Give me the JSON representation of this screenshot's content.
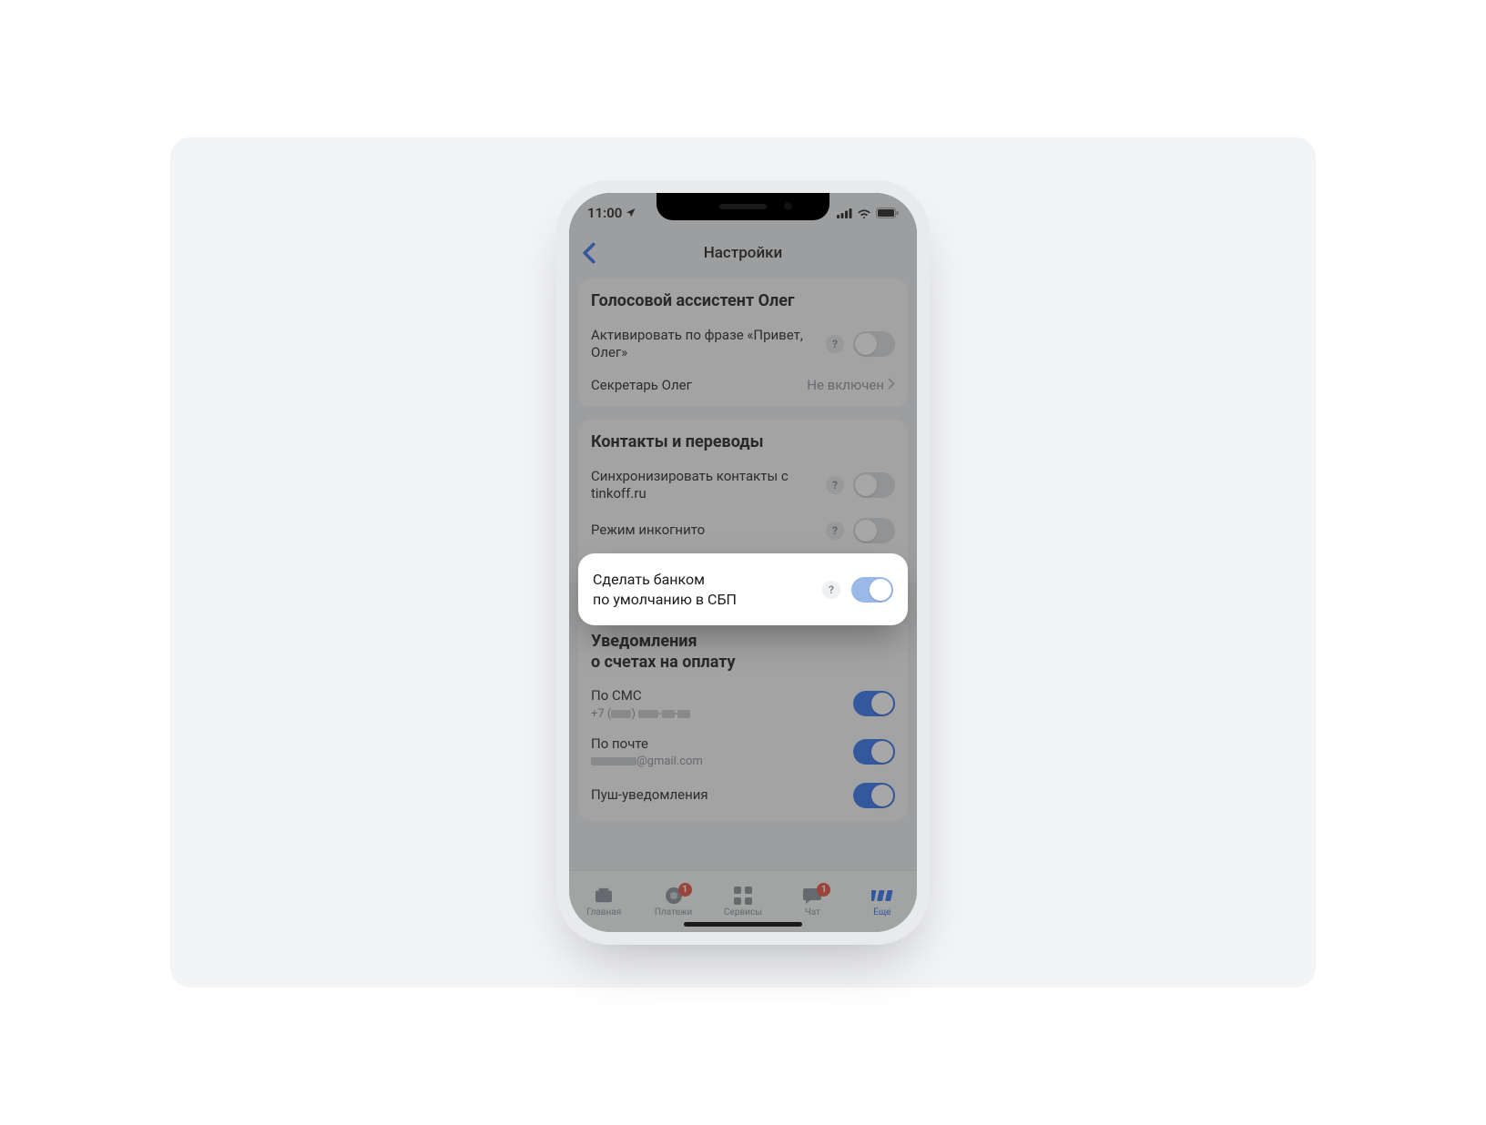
{
  "status": {
    "time": "11:00"
  },
  "nav": {
    "title": "Настройки"
  },
  "section_oleg": {
    "title": "Голосовой ассистент Олег",
    "activate_label": "Активировать по фразе «Привет, Олег»",
    "secretary_label": "Секретарь Олег",
    "secretary_value": "Не включен"
  },
  "section_contacts": {
    "title": "Контакты и переводы",
    "sync_label": "Синхронизировать контакты с tinkoff.ru",
    "incognito_label": "Режим инкогнито",
    "sbp_label": "Сделать банком по умолчанию в СБП"
  },
  "section_notify": {
    "title": "Уведомления о счетах на оплату",
    "sms_label": "По СМС",
    "sms_sub_prefix": "+7 (",
    "sms_sub_suffix": ")",
    "email_label": "По почте",
    "email_suffix": "@gmail.com",
    "push_label": "Пуш-уведомления"
  },
  "tabs": {
    "home": "Главная",
    "payments": "Платежи",
    "services": "Сервисы",
    "chat": "Чат",
    "more": "Еще",
    "badge_payments": "1",
    "badge_chat": "1"
  },
  "help_glyph": "?"
}
